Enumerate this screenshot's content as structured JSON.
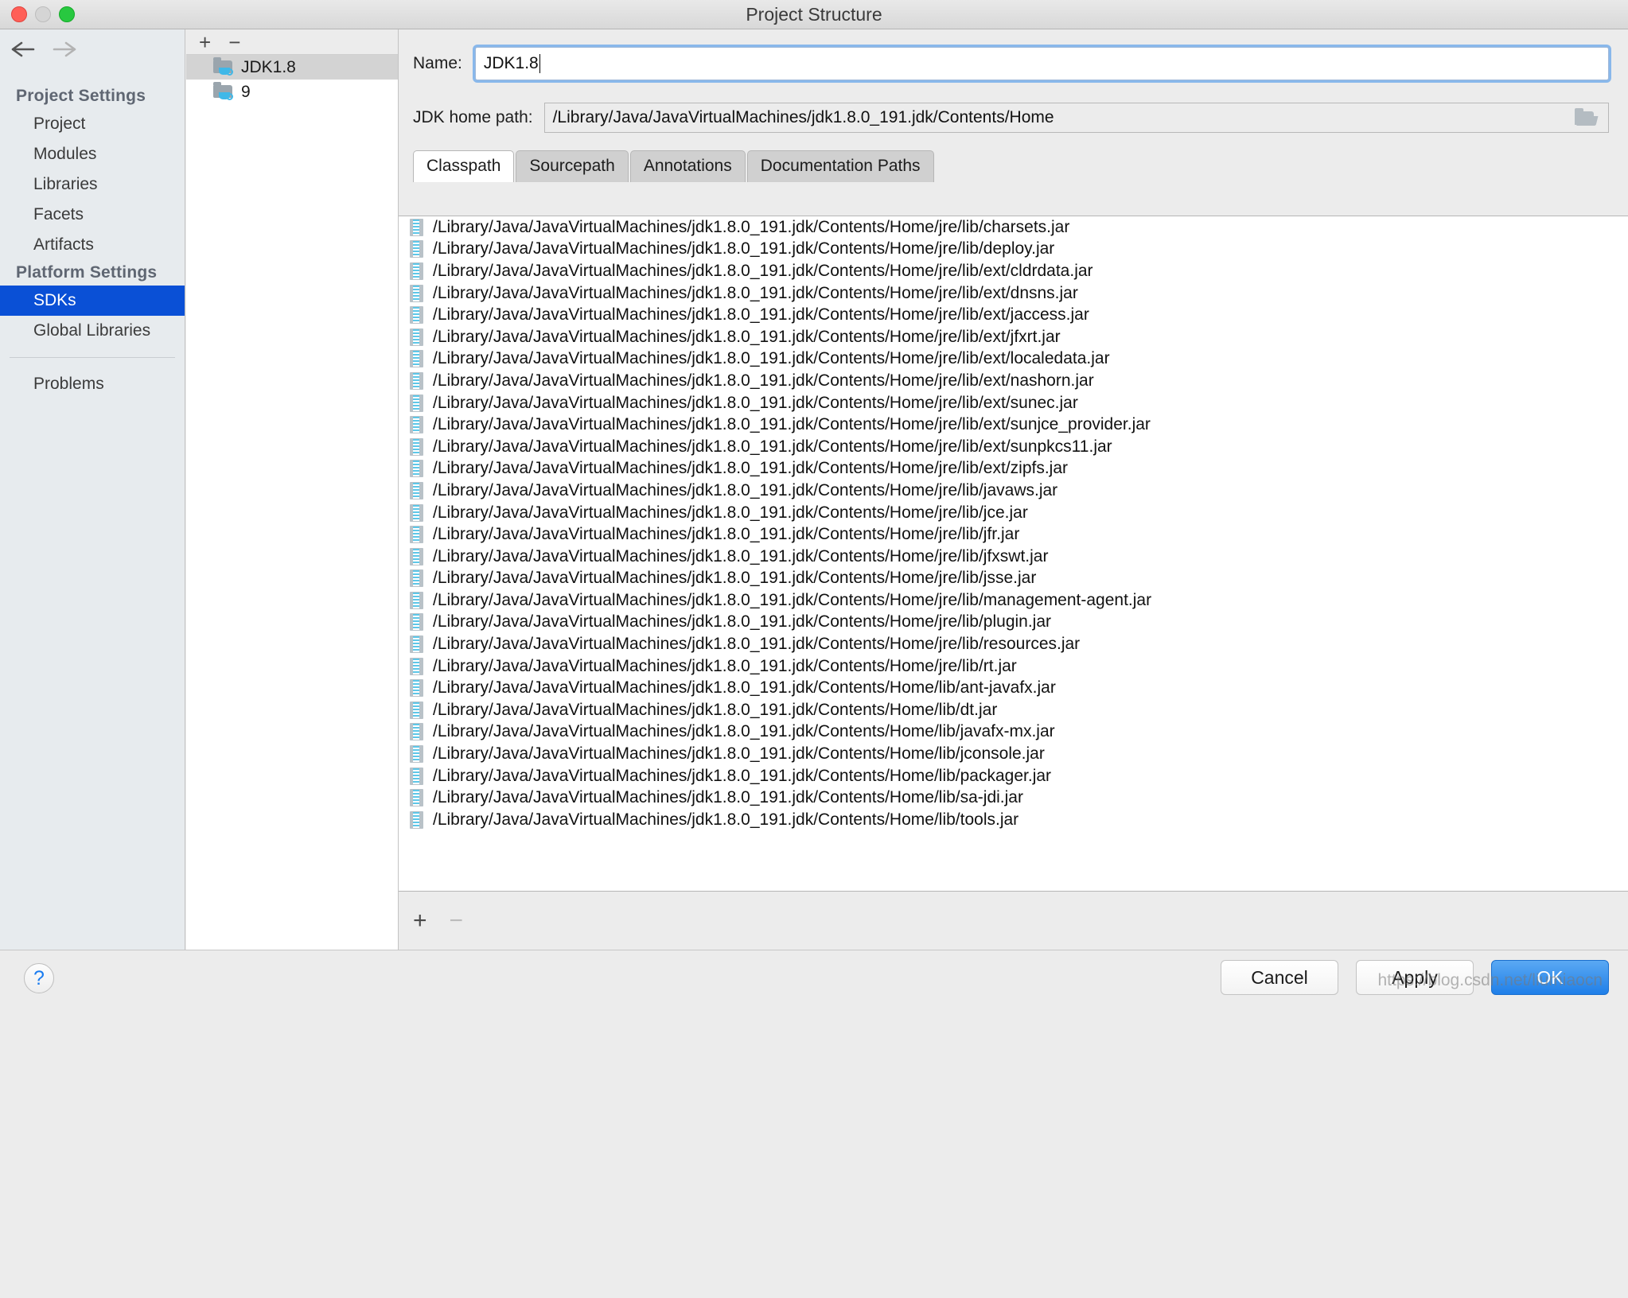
{
  "window": {
    "title": "Project Structure",
    "traffic_lights": [
      "close-red",
      "minimize-gray",
      "maximize-green"
    ]
  },
  "sidebar": {
    "back_icon": "back-arrow-icon",
    "forward_icon": "forward-arrow-icon",
    "groups": [
      {
        "title": "Project Settings",
        "items": [
          {
            "label": "Project",
            "selected": false
          },
          {
            "label": "Modules",
            "selected": false
          },
          {
            "label": "Libraries",
            "selected": false
          },
          {
            "label": "Facets",
            "selected": false
          },
          {
            "label": "Artifacts",
            "selected": false
          }
        ]
      },
      {
        "title": "Platform Settings",
        "items": [
          {
            "label": "SDKs",
            "selected": true
          },
          {
            "label": "Global Libraries",
            "selected": false
          }
        ]
      }
    ],
    "footer_items": [
      {
        "label": "Problems",
        "selected": false
      }
    ]
  },
  "sdk_panel": {
    "toolbar": {
      "add_label": "+",
      "remove_label": "−"
    },
    "items": [
      {
        "label": "JDK1.8",
        "selected": true,
        "icon": "jdk-folder-icon"
      },
      {
        "label": "9",
        "selected": false,
        "icon": "jdk-folder-icon"
      }
    ]
  },
  "detail": {
    "name_label": "Name:",
    "name_value": "JDK1.8",
    "name_placeholder": "",
    "home_path_label": "JDK home path:",
    "home_path_value": "/Library/Java/JavaVirtualMachines/jdk1.8.0_191.jdk/Contents/Home",
    "browse_icon": "folder-open-icon",
    "tabs": [
      {
        "label": "Classpath",
        "active": true
      },
      {
        "label": "Sourcepath",
        "active": false
      },
      {
        "label": "Annotations",
        "active": false
      },
      {
        "label": "Documentation Paths",
        "active": false
      }
    ],
    "classpath_entries": [
      "/Library/Java/JavaVirtualMachines/jdk1.8.0_191.jdk/Contents/Home/jre/lib/charsets.jar",
      "/Library/Java/JavaVirtualMachines/jdk1.8.0_191.jdk/Contents/Home/jre/lib/deploy.jar",
      "/Library/Java/JavaVirtualMachines/jdk1.8.0_191.jdk/Contents/Home/jre/lib/ext/cldrdata.jar",
      "/Library/Java/JavaVirtualMachines/jdk1.8.0_191.jdk/Contents/Home/jre/lib/ext/dnsns.jar",
      "/Library/Java/JavaVirtualMachines/jdk1.8.0_191.jdk/Contents/Home/jre/lib/ext/jaccess.jar",
      "/Library/Java/JavaVirtualMachines/jdk1.8.0_191.jdk/Contents/Home/jre/lib/ext/jfxrt.jar",
      "/Library/Java/JavaVirtualMachines/jdk1.8.0_191.jdk/Contents/Home/jre/lib/ext/localedata.jar",
      "/Library/Java/JavaVirtualMachines/jdk1.8.0_191.jdk/Contents/Home/jre/lib/ext/nashorn.jar",
      "/Library/Java/JavaVirtualMachines/jdk1.8.0_191.jdk/Contents/Home/jre/lib/ext/sunec.jar",
      "/Library/Java/JavaVirtualMachines/jdk1.8.0_191.jdk/Contents/Home/jre/lib/ext/sunjce_provider.jar",
      "/Library/Java/JavaVirtualMachines/jdk1.8.0_191.jdk/Contents/Home/jre/lib/ext/sunpkcs11.jar",
      "/Library/Java/JavaVirtualMachines/jdk1.8.0_191.jdk/Contents/Home/jre/lib/ext/zipfs.jar",
      "/Library/Java/JavaVirtualMachines/jdk1.8.0_191.jdk/Contents/Home/jre/lib/javaws.jar",
      "/Library/Java/JavaVirtualMachines/jdk1.8.0_191.jdk/Contents/Home/jre/lib/jce.jar",
      "/Library/Java/JavaVirtualMachines/jdk1.8.0_191.jdk/Contents/Home/jre/lib/jfr.jar",
      "/Library/Java/JavaVirtualMachines/jdk1.8.0_191.jdk/Contents/Home/jre/lib/jfxswt.jar",
      "/Library/Java/JavaVirtualMachines/jdk1.8.0_191.jdk/Contents/Home/jre/lib/jsse.jar",
      "/Library/Java/JavaVirtualMachines/jdk1.8.0_191.jdk/Contents/Home/jre/lib/management-agent.jar",
      "/Library/Java/JavaVirtualMachines/jdk1.8.0_191.jdk/Contents/Home/jre/lib/plugin.jar",
      "/Library/Java/JavaVirtualMachines/jdk1.8.0_191.jdk/Contents/Home/jre/lib/resources.jar",
      "/Library/Java/JavaVirtualMachines/jdk1.8.0_191.jdk/Contents/Home/jre/lib/rt.jar",
      "/Library/Java/JavaVirtualMachines/jdk1.8.0_191.jdk/Contents/Home/lib/ant-javafx.jar",
      "/Library/Java/JavaVirtualMachines/jdk1.8.0_191.jdk/Contents/Home/lib/dt.jar",
      "/Library/Java/JavaVirtualMachines/jdk1.8.0_191.jdk/Contents/Home/lib/javafx-mx.jar",
      "/Library/Java/JavaVirtualMachines/jdk1.8.0_191.jdk/Contents/Home/lib/jconsole.jar",
      "/Library/Java/JavaVirtualMachines/jdk1.8.0_191.jdk/Contents/Home/lib/packager.jar",
      "/Library/Java/JavaVirtualMachines/jdk1.8.0_191.jdk/Contents/Home/lib/sa-jdi.jar",
      "/Library/Java/JavaVirtualMachines/jdk1.8.0_191.jdk/Contents/Home/lib/tools.jar"
    ],
    "list_toolbar": {
      "add_label": "+",
      "remove_label": "−"
    }
  },
  "footer": {
    "help_label": "?",
    "cancel_label": "Cancel",
    "apply_label": "Apply",
    "ok_label": "OK",
    "watermark": "https://blog.csdn.net/liumiaocn"
  },
  "colors": {
    "selection_blue": "#0a50d6",
    "primary_button": "#1f7fe8",
    "focus_ring": "#78afeb",
    "sidebar_bg": "#e7ebee"
  }
}
